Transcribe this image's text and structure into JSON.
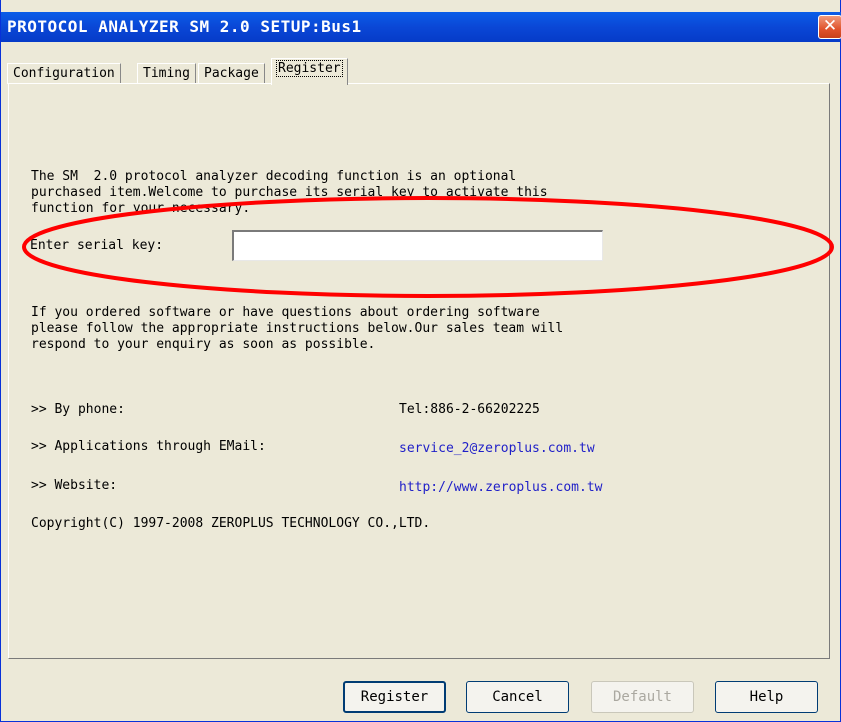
{
  "window": {
    "title": "PROTOCOL ANALYZER SM 2.0 SETUP:Bus1",
    "close_glyph": "✕"
  },
  "tabs": [
    {
      "label": "Configuration",
      "active": false
    },
    {
      "label": "Timing",
      "active": false
    },
    {
      "label": "Package",
      "active": false
    },
    {
      "label": "Register",
      "active": true
    }
  ],
  "register": {
    "intro": "The SM  2.0 protocol analyzer decoding function is an optional\npurchased item.Welcome to purchase its serial key to activate this\nfunction for your necessary.",
    "serial_label": "Enter serial key:",
    "serial_value": "",
    "ordering_text": "If you ordered software or have questions about ordering software\nplease follow the appropriate instructions below.Our sales team will\nrespond to your enquiry as soon as possible.",
    "contacts": [
      {
        "label": ">> By phone:",
        "value": "Tel:886-2-66202225"
      },
      {
        "label": ">> Applications through EMail:",
        "value": "service_2@zeroplus.com.tw"
      },
      {
        "label": ">> Website:",
        "value": "http://www.zeroplus.com.tw"
      }
    ],
    "copyright": "Copyright(C) 1997-2008 ZEROPLUS TECHNOLOGY CO.,LTD."
  },
  "buttons": {
    "register": "Register",
    "cancel": "Cancel",
    "default": "Default",
    "help": "Help"
  },
  "colors": {
    "titlebar": "#0a47d6",
    "window_bg": "#ece9d8",
    "link": "#1f1fc8",
    "annotation": "#ff0000"
  }
}
